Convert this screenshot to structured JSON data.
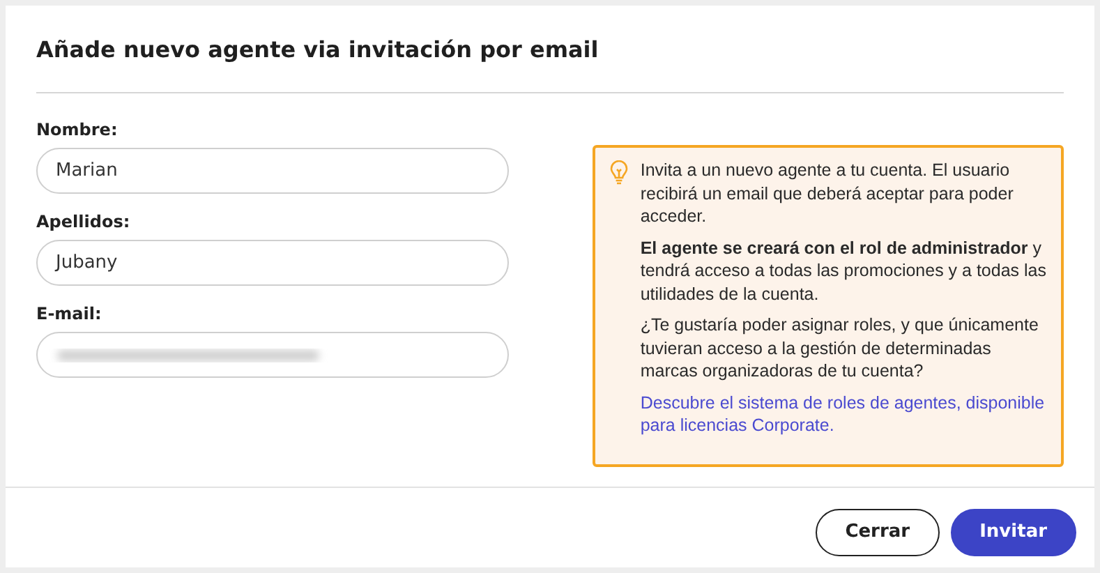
{
  "dialog": {
    "title": "Añade nuevo agente via invitación por email"
  },
  "fields": [
    {
      "label": "Nombre:",
      "value": "Marian",
      "kind": "text"
    },
    {
      "label": "Apellidos:",
      "value": "Jubany",
      "kind": "text"
    },
    {
      "label": "E-mail:",
      "kind": "redacted"
    }
  ],
  "info": {
    "paragraphs": [
      "Invita a un nuevo agente a tu cuenta. El usuario recibirá un email que deberá aceptar para poder acceder.",
      "**El agente se creará con el rol de administrador** y tendrá acceso a todas las promociones y a todas las utilidades de la cuenta.",
      "¿Te gustaría poder asignar roles, y que únicamente tuvieran acceso a la gestión de determinadas marcas organizadoras de tu cuenta?"
    ],
    "link": "Descubre el sistema de roles de agentes, disponible para licencias Corporate."
  },
  "buttons": [
    {
      "label": "Cerrar",
      "kind": "secondary"
    },
    {
      "label": "Invitar",
      "kind": "primary"
    }
  ]
}
